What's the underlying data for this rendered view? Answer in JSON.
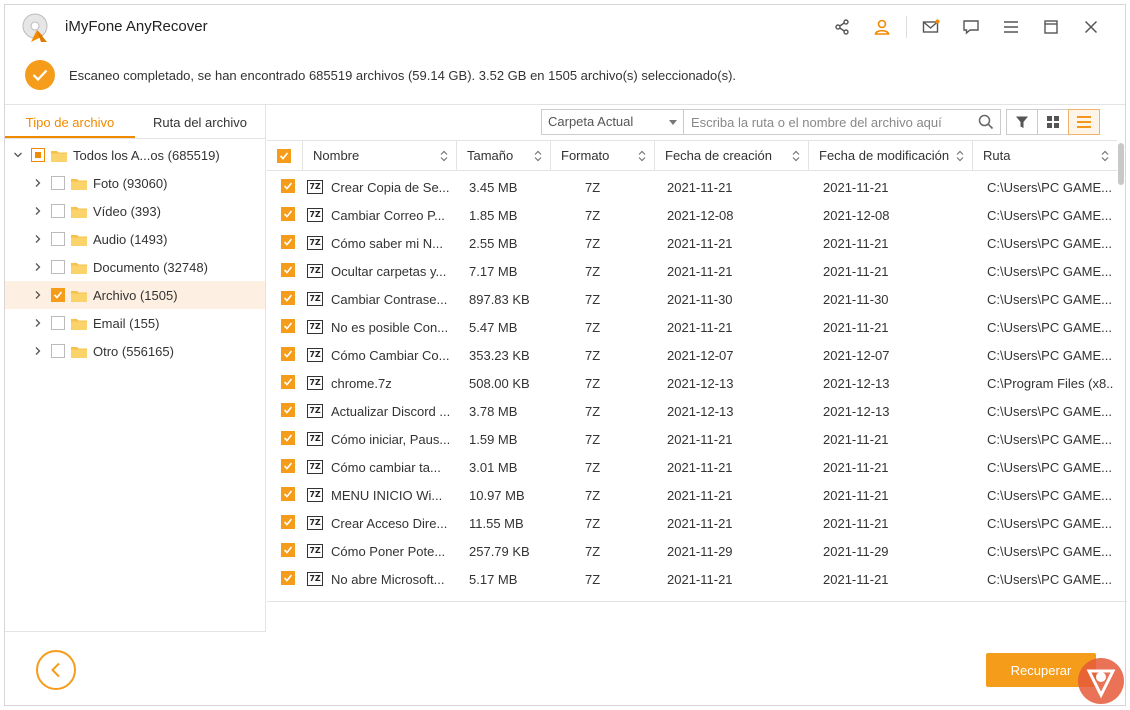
{
  "app": {
    "title": "iMyFone AnyRecover"
  },
  "status": {
    "message": "Escaneo completado, se han encontrado 685519 archivos (59.14 GB). 3.52 GB en 1505 archivo(s) seleccionado(s)."
  },
  "left_tabs": [
    {
      "label": "Tipo de archivo",
      "active": true
    },
    {
      "label": "Ruta del archivo",
      "active": false
    }
  ],
  "tree": {
    "root": {
      "label": "Todos los A...os (685519)"
    },
    "items": [
      {
        "label": "Foto (93060)"
      },
      {
        "label": "Vídeo (393)"
      },
      {
        "label": "Audio (1493)"
      },
      {
        "label": "Documento (32748)"
      },
      {
        "label": "Archivo (1505)",
        "selected": true
      },
      {
        "label": "Email (155)"
      },
      {
        "label": "Otro (556165)"
      }
    ]
  },
  "search": {
    "location_select": "Carpeta Actual",
    "placeholder": "Escriba la ruta o el nombre del archivo aquí"
  },
  "table": {
    "columns": [
      "Nombre",
      "Tamaño",
      "Formato",
      "Fecha de creación",
      "Fecha de modificación",
      "Ruta"
    ],
    "rows": [
      {
        "name": "Crear Copia de Se...",
        "size": "3.45 MB",
        "format": "7Z",
        "created": "2021-11-21",
        "modified": "2021-11-21",
        "path": "C:\\Users\\PC GAME..."
      },
      {
        "name": "Cambiar Correo P...",
        "size": "1.85 MB",
        "format": "7Z",
        "created": "2021-12-08",
        "modified": "2021-12-08",
        "path": "C:\\Users\\PC GAME..."
      },
      {
        "name": "Cómo saber mi N...",
        "size": "2.55 MB",
        "format": "7Z",
        "created": "2021-11-21",
        "modified": "2021-11-21",
        "path": "C:\\Users\\PC GAME..."
      },
      {
        "name": "Ocultar carpetas y...",
        "size": "7.17 MB",
        "format": "7Z",
        "created": "2021-11-21",
        "modified": "2021-11-21",
        "path": "C:\\Users\\PC GAME..."
      },
      {
        "name": "Cambiar Contrase...",
        "size": "897.83 KB",
        "format": "7Z",
        "created": "2021-11-30",
        "modified": "2021-11-30",
        "path": "C:\\Users\\PC GAME..."
      },
      {
        "name": "No es posible Con...",
        "size": "5.47 MB",
        "format": "7Z",
        "created": "2021-11-21",
        "modified": "2021-11-21",
        "path": "C:\\Users\\PC GAME..."
      },
      {
        "name": "Cómo Cambiar Co...",
        "size": "353.23 KB",
        "format": "7Z",
        "created": "2021-12-07",
        "modified": "2021-12-07",
        "path": "C:\\Users\\PC GAME..."
      },
      {
        "name": "chrome.7z",
        "size": "508.00 KB",
        "format": "7Z",
        "created": "2021-12-13",
        "modified": "2021-12-13",
        "path": "C:\\Program Files (x8..."
      },
      {
        "name": "Actualizar Discord ...",
        "size": "3.78 MB",
        "format": "7Z",
        "created": "2021-12-13",
        "modified": "2021-12-13",
        "path": "C:\\Users\\PC GAME..."
      },
      {
        "name": "Cómo iniciar, Paus...",
        "size": "1.59 MB",
        "format": "7Z",
        "created": "2021-11-21",
        "modified": "2021-11-21",
        "path": "C:\\Users\\PC GAME..."
      },
      {
        "name": "Cómo cambiar ta...",
        "size": "3.01 MB",
        "format": "7Z",
        "created": "2021-11-21",
        "modified": "2021-11-21",
        "path": "C:\\Users\\PC GAME..."
      },
      {
        "name": "MENU INICIO Wi...",
        "size": "10.97 MB",
        "format": "7Z",
        "created": "2021-11-21",
        "modified": "2021-11-21",
        "path": "C:\\Users\\PC GAME..."
      },
      {
        "name": "Crear Acceso Dire...",
        "size": "11.55 MB",
        "format": "7Z",
        "created": "2021-11-21",
        "modified": "2021-11-21",
        "path": "C:\\Users\\PC GAME..."
      },
      {
        "name": "Cómo Poner Pote...",
        "size": "257.79 KB",
        "format": "7Z",
        "created": "2021-11-29",
        "modified": "2021-11-29",
        "path": "C:\\Users\\PC GAME..."
      },
      {
        "name": "No abre Microsoft...",
        "size": "5.17 MB",
        "format": "7Z",
        "created": "2021-11-21",
        "modified": "2021-11-21",
        "path": "C:\\Users\\PC GAME..."
      }
    ]
  },
  "file_icon_label": "7Z",
  "footer": {
    "recover_label": "Recuperar"
  },
  "colors": {
    "accent": "#f59c1a",
    "accent_dark": "#f08a00",
    "selected_row": "#fdf0e2"
  },
  "icons": [
    "share-icon",
    "user-icon",
    "mail-icon",
    "feedback-icon",
    "menu-icon",
    "maximize-icon",
    "close-icon",
    "filter-icon",
    "grid-view-icon",
    "list-view-icon",
    "search-icon",
    "back-arrow-icon"
  ]
}
